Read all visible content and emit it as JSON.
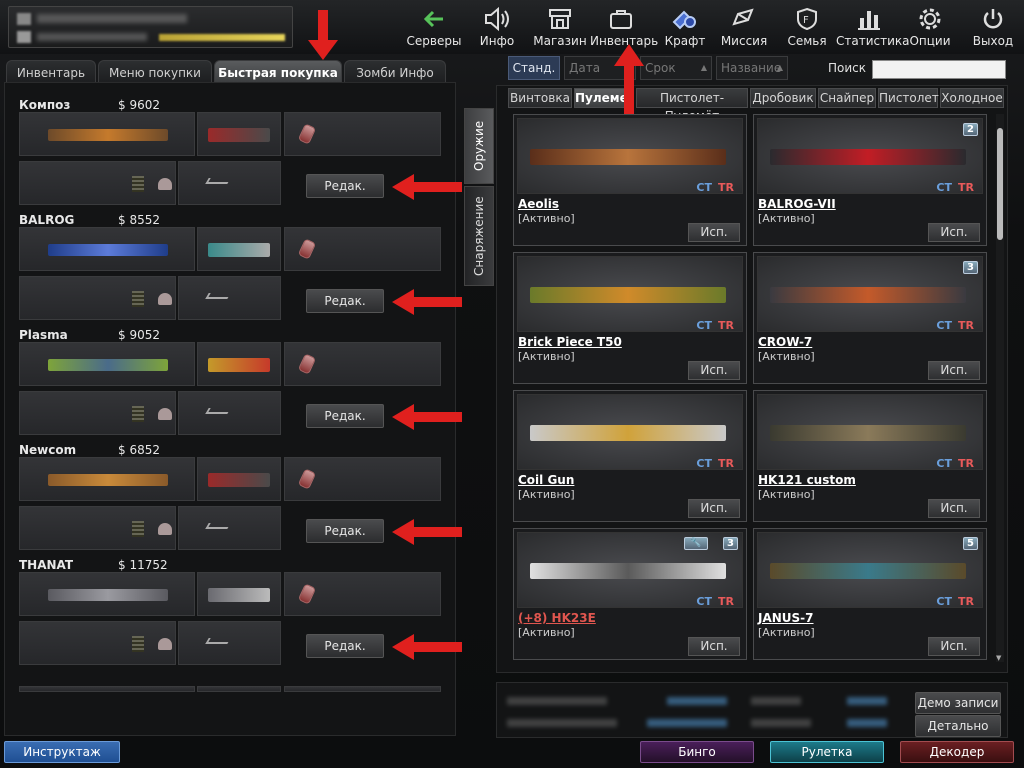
{
  "top_nav": [
    {
      "id": "servers",
      "label": "Серверы",
      "icon": "back-arrow-icon"
    },
    {
      "id": "info",
      "label": "Инфо",
      "icon": "speaker-icon"
    },
    {
      "id": "shop",
      "label": "Магазин",
      "icon": "shop-icon"
    },
    {
      "id": "inventory",
      "label": "Инвентарь",
      "icon": "briefcase-icon"
    },
    {
      "id": "craft",
      "label": "Крафт",
      "icon": "craft-icon"
    },
    {
      "id": "mission",
      "label": "Миссия",
      "icon": "mission-icon"
    },
    {
      "id": "family",
      "label": "Семья",
      "icon": "family-shield-icon"
    },
    {
      "id": "stats",
      "label": "Статистика",
      "icon": "stats-bars-icon"
    },
    {
      "id": "options",
      "label": "Опции",
      "icon": "gear-icon"
    },
    {
      "id": "exit",
      "label": "Выход",
      "icon": "power-icon"
    }
  ],
  "left_tabs": [
    {
      "label": "Инвентарь",
      "active": false
    },
    {
      "label": "Меню покупки",
      "active": false
    },
    {
      "label": "Быстрая покупка",
      "active": true
    },
    {
      "label": "Зомби Инфо",
      "active": false
    }
  ],
  "side_tabs": {
    "weapons": "Оружие",
    "equipment": "Снаряжение"
  },
  "quick_buy_sets": [
    {
      "name": "Композ",
      "price": "$ 9602",
      "edit": "Редак."
    },
    {
      "name": "BALROG",
      "price": "$ 8552",
      "edit": "Редак."
    },
    {
      "name": "Plasma",
      "price": "$ 9052",
      "edit": "Редак."
    },
    {
      "name": "Newcom",
      "price": "$ 6852",
      "edit": "Редак."
    },
    {
      "name": "THANAT",
      "price": "$ 11752",
      "edit": "Редак."
    }
  ],
  "filters": {
    "standard": "Станд.",
    "date": "Дата",
    "term": "Срок",
    "name": "Название",
    "search_label": "Поиск",
    "search_value": ""
  },
  "categories": [
    {
      "label": "Винтовка",
      "active": false
    },
    {
      "label": "Пулемет",
      "active": true
    },
    {
      "label": "Пистолет-Пулемёт",
      "active": false
    },
    {
      "label": "Дробовик",
      "active": false
    },
    {
      "label": "Снайпер",
      "active": false
    },
    {
      "label": "Пистолет",
      "active": false
    },
    {
      "label": "Холодное",
      "active": false
    }
  ],
  "inventory_items": [
    {
      "name": "Aeolis",
      "status": "[Активно]",
      "use": "Исп.",
      "ct": "CT",
      "tr": "TR",
      "badge": ""
    },
    {
      "name": "BALROG-VII",
      "status": "[Активно]",
      "use": "Исп.",
      "ct": "CT",
      "tr": "TR",
      "badge": "2"
    },
    {
      "name": "Brick Piece T50",
      "status": "[Активно]",
      "use": "Исп.",
      "ct": "CT",
      "tr": "TR",
      "badge": ""
    },
    {
      "name": "CROW-7",
      "status": "[Активно]",
      "use": "Исп.",
      "ct": "CT",
      "tr": "TR",
      "badge": "3"
    },
    {
      "name": "Coil Gun",
      "status": "[Активно]",
      "use": "Исп.",
      "ct": "CT",
      "tr": "TR",
      "badge": ""
    },
    {
      "name": "HK121 custom",
      "status": "[Активно]",
      "use": "Исп.",
      "ct": "CT",
      "tr": "TR",
      "badge": ""
    },
    {
      "name": "(+8) HK23E",
      "status": "[Активно]",
      "use": "Исп.",
      "ct": "CT",
      "tr": "TR",
      "badge": "3"
    },
    {
      "name": "JANUS-7",
      "status": "[Активно]",
      "use": "Исп.",
      "ct": "CT",
      "tr": "TR",
      "badge": "5"
    }
  ],
  "stats_buttons": {
    "demo": "Демо записи",
    "details": "Детально"
  },
  "bottom_buttons": {
    "briefing": "Инструктаж",
    "bingo": "Бинго",
    "roulette": "Рулетка",
    "decoder": "Декодер"
  },
  "colors": {
    "accent_red": "#e0201e",
    "ct_blue": "#6a9fdc",
    "tr_red": "#e85a5a"
  }
}
